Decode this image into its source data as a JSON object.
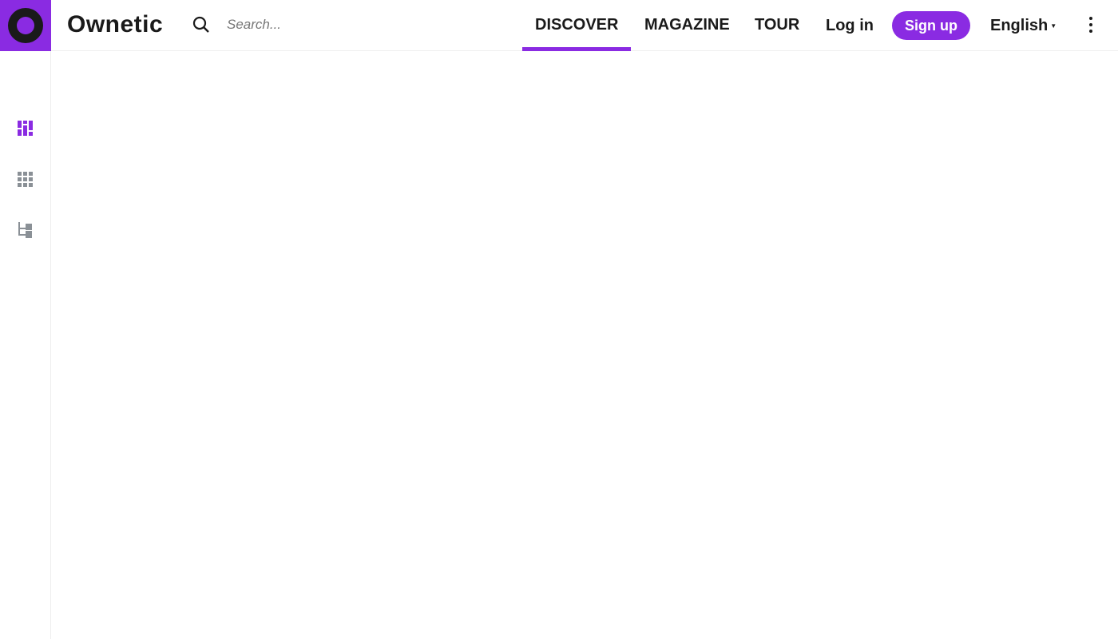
{
  "header": {
    "brand": "Ownetic",
    "search_placeholder": "Search...",
    "nav": [
      "DISCOVER",
      "MAGAZINE",
      "TOUR"
    ],
    "login": "Log in",
    "signup": "Sign up",
    "language": "English",
    "accent": "#8a2be2"
  },
  "sidebar": {
    "items": [
      "masonry-view-icon",
      "grid-view-icon",
      "tree-view-icon"
    ]
  }
}
